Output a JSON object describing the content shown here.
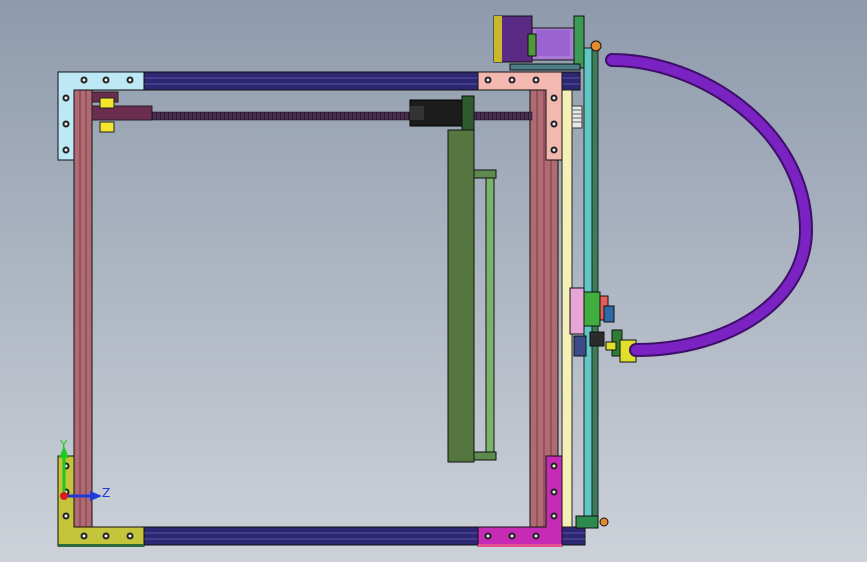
{
  "viewport": {
    "background_top": "#8e9aac",
    "background_bottom": "#cdd2d9"
  },
  "triad": {
    "y_label": "Y",
    "z_label": "Z",
    "y_color": "#1ec81e",
    "z_color": "#1e3ad8",
    "x_color": "#d81e1e"
  },
  "colors": {
    "extrusion_red": "#b06a73",
    "extrusion_navy": "#2d2670",
    "bracket_lightblue": "#bde8f6",
    "bracket_peach": "#f3b9b1",
    "bracket_olive": "#c6c43a",
    "bracket_magenta": "#c62bb5",
    "bracket_pink": "#e64e8d",
    "plate_green": "#55773f",
    "cable_purple": "#7a22c2",
    "motor_purple": "#5b2a85",
    "rail_cyan": "#5fc7c4",
    "rail_yellow": "#f5f0b6"
  }
}
